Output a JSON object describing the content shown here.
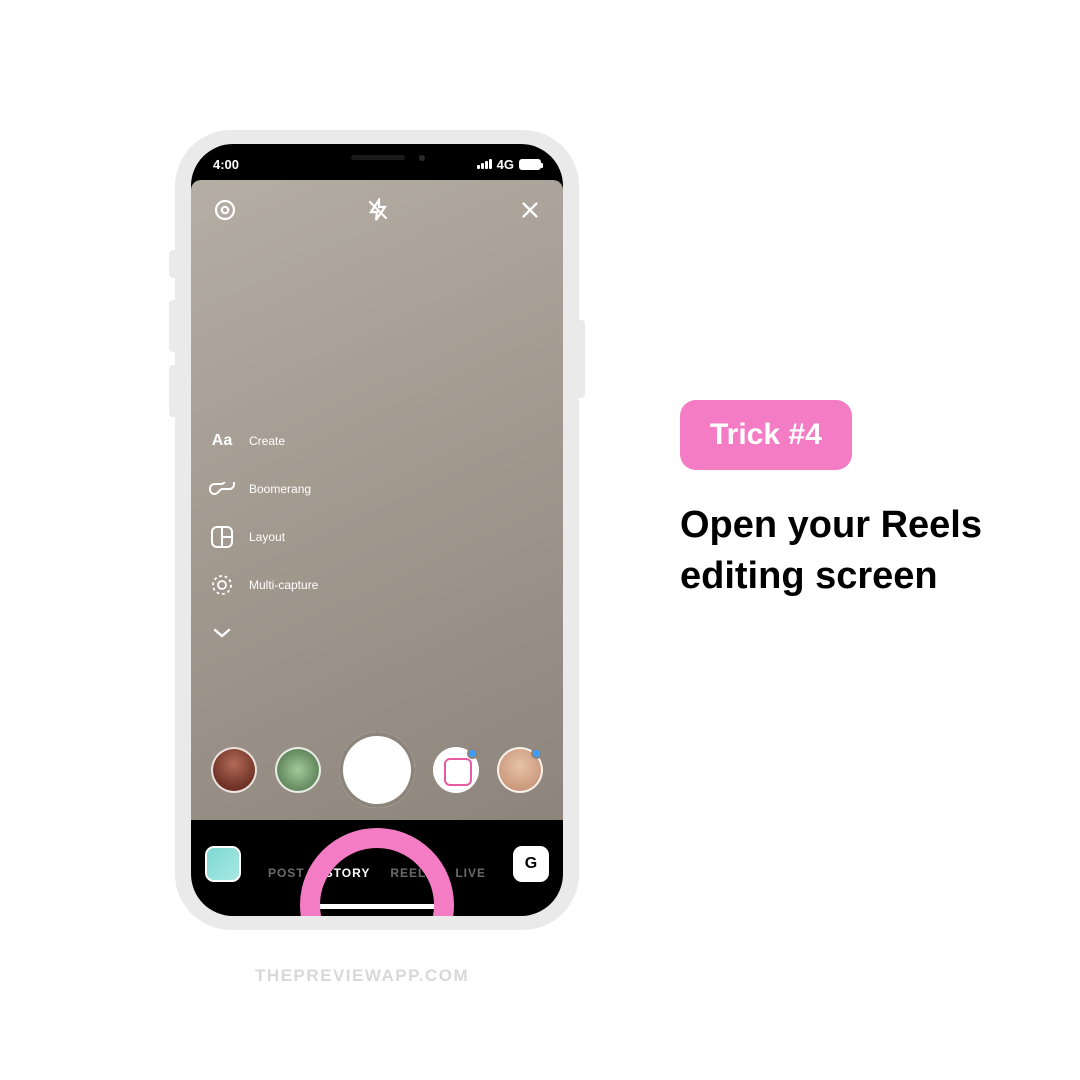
{
  "status": {
    "time": "4:00",
    "network": "4G"
  },
  "tools": {
    "create": {
      "label": "Create",
      "icon": "Aa"
    },
    "boomerang": {
      "label": "Boomerang"
    },
    "layout": {
      "label": "Layout"
    },
    "multi": {
      "label": "Multi-capture"
    }
  },
  "modes": {
    "post": "POST",
    "story": "STORY",
    "reels": "REELS",
    "live": "LIVE"
  },
  "switch_label": "G",
  "badge": "Trick #4",
  "instruction": "Open your Reels editing screen",
  "watermark": "THEPREVIEWAPP.COM",
  "colors": {
    "pink": "#f47cc4"
  }
}
